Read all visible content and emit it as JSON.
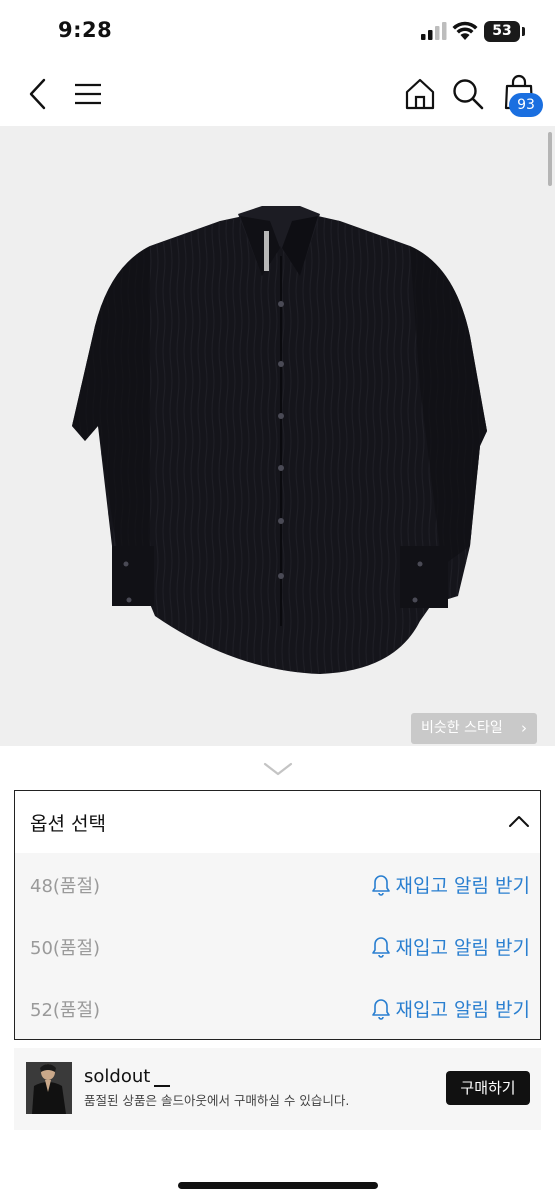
{
  "status_bar": {
    "time": "9:28",
    "battery": "53"
  },
  "cart": {
    "count": "93"
  },
  "product": {
    "similar_style_label": "비슷한 스타일"
  },
  "options": {
    "title": "옵션 선택",
    "rows": [
      {
        "size": "48(품절)",
        "restock_label": "재입고 알림 받기"
      },
      {
        "size": "50(품절)",
        "restock_label": "재입고 알림 받기"
      },
      {
        "size": "52(품절)",
        "restock_label": "재입고 알림 받기"
      }
    ]
  },
  "soldout": {
    "logo": "soldout",
    "description": "품절된 상품은 솔드아웃에서 구매하실 수 있습니다.",
    "buy_label": "구매하기"
  },
  "colors": {
    "accent_blue": "#2a7fd0",
    "badge_blue": "#1a6fe0"
  }
}
